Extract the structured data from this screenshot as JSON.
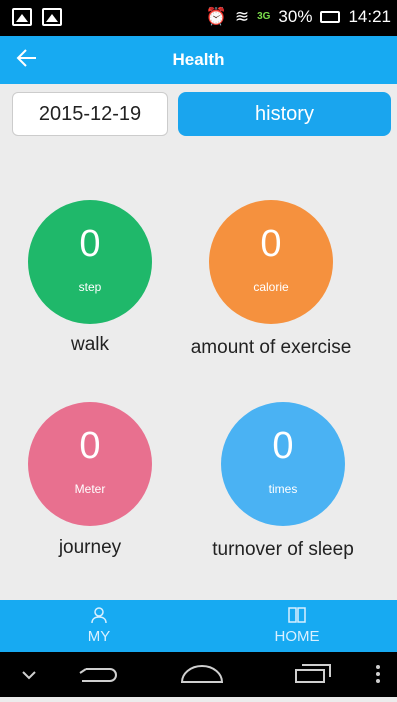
{
  "status_bar": {
    "battery": "30%",
    "time": "14:21",
    "network": "3G"
  },
  "app_bar": {
    "title": "Health",
    "back_icon": "arrow-left-icon"
  },
  "date_field": {
    "value": "2015-12-19"
  },
  "history_button": {
    "label": "history"
  },
  "stats": [
    {
      "value": "0",
      "unit": "step",
      "label": "walk",
      "color": "#1fb86a"
    },
    {
      "value": "0",
      "unit": "calorie",
      "label": "amount of exercise",
      "color": "#f5913e"
    },
    {
      "value": "0",
      "unit": "Meter",
      "label": "journey",
      "color": "#e8708f"
    },
    {
      "value": "0",
      "unit": "times",
      "label": "turnover of sleep",
      "color": "#4ab2f3"
    }
  ],
  "tabs": [
    {
      "label": "MY",
      "icon": "person-icon"
    },
    {
      "label": "HOME",
      "icon": "book-icon"
    }
  ],
  "nav": {
    "icons": [
      "chevron-down-icon",
      "back-icon",
      "home-icon",
      "recent-apps-icon",
      "overflow-menu-icon"
    ]
  }
}
